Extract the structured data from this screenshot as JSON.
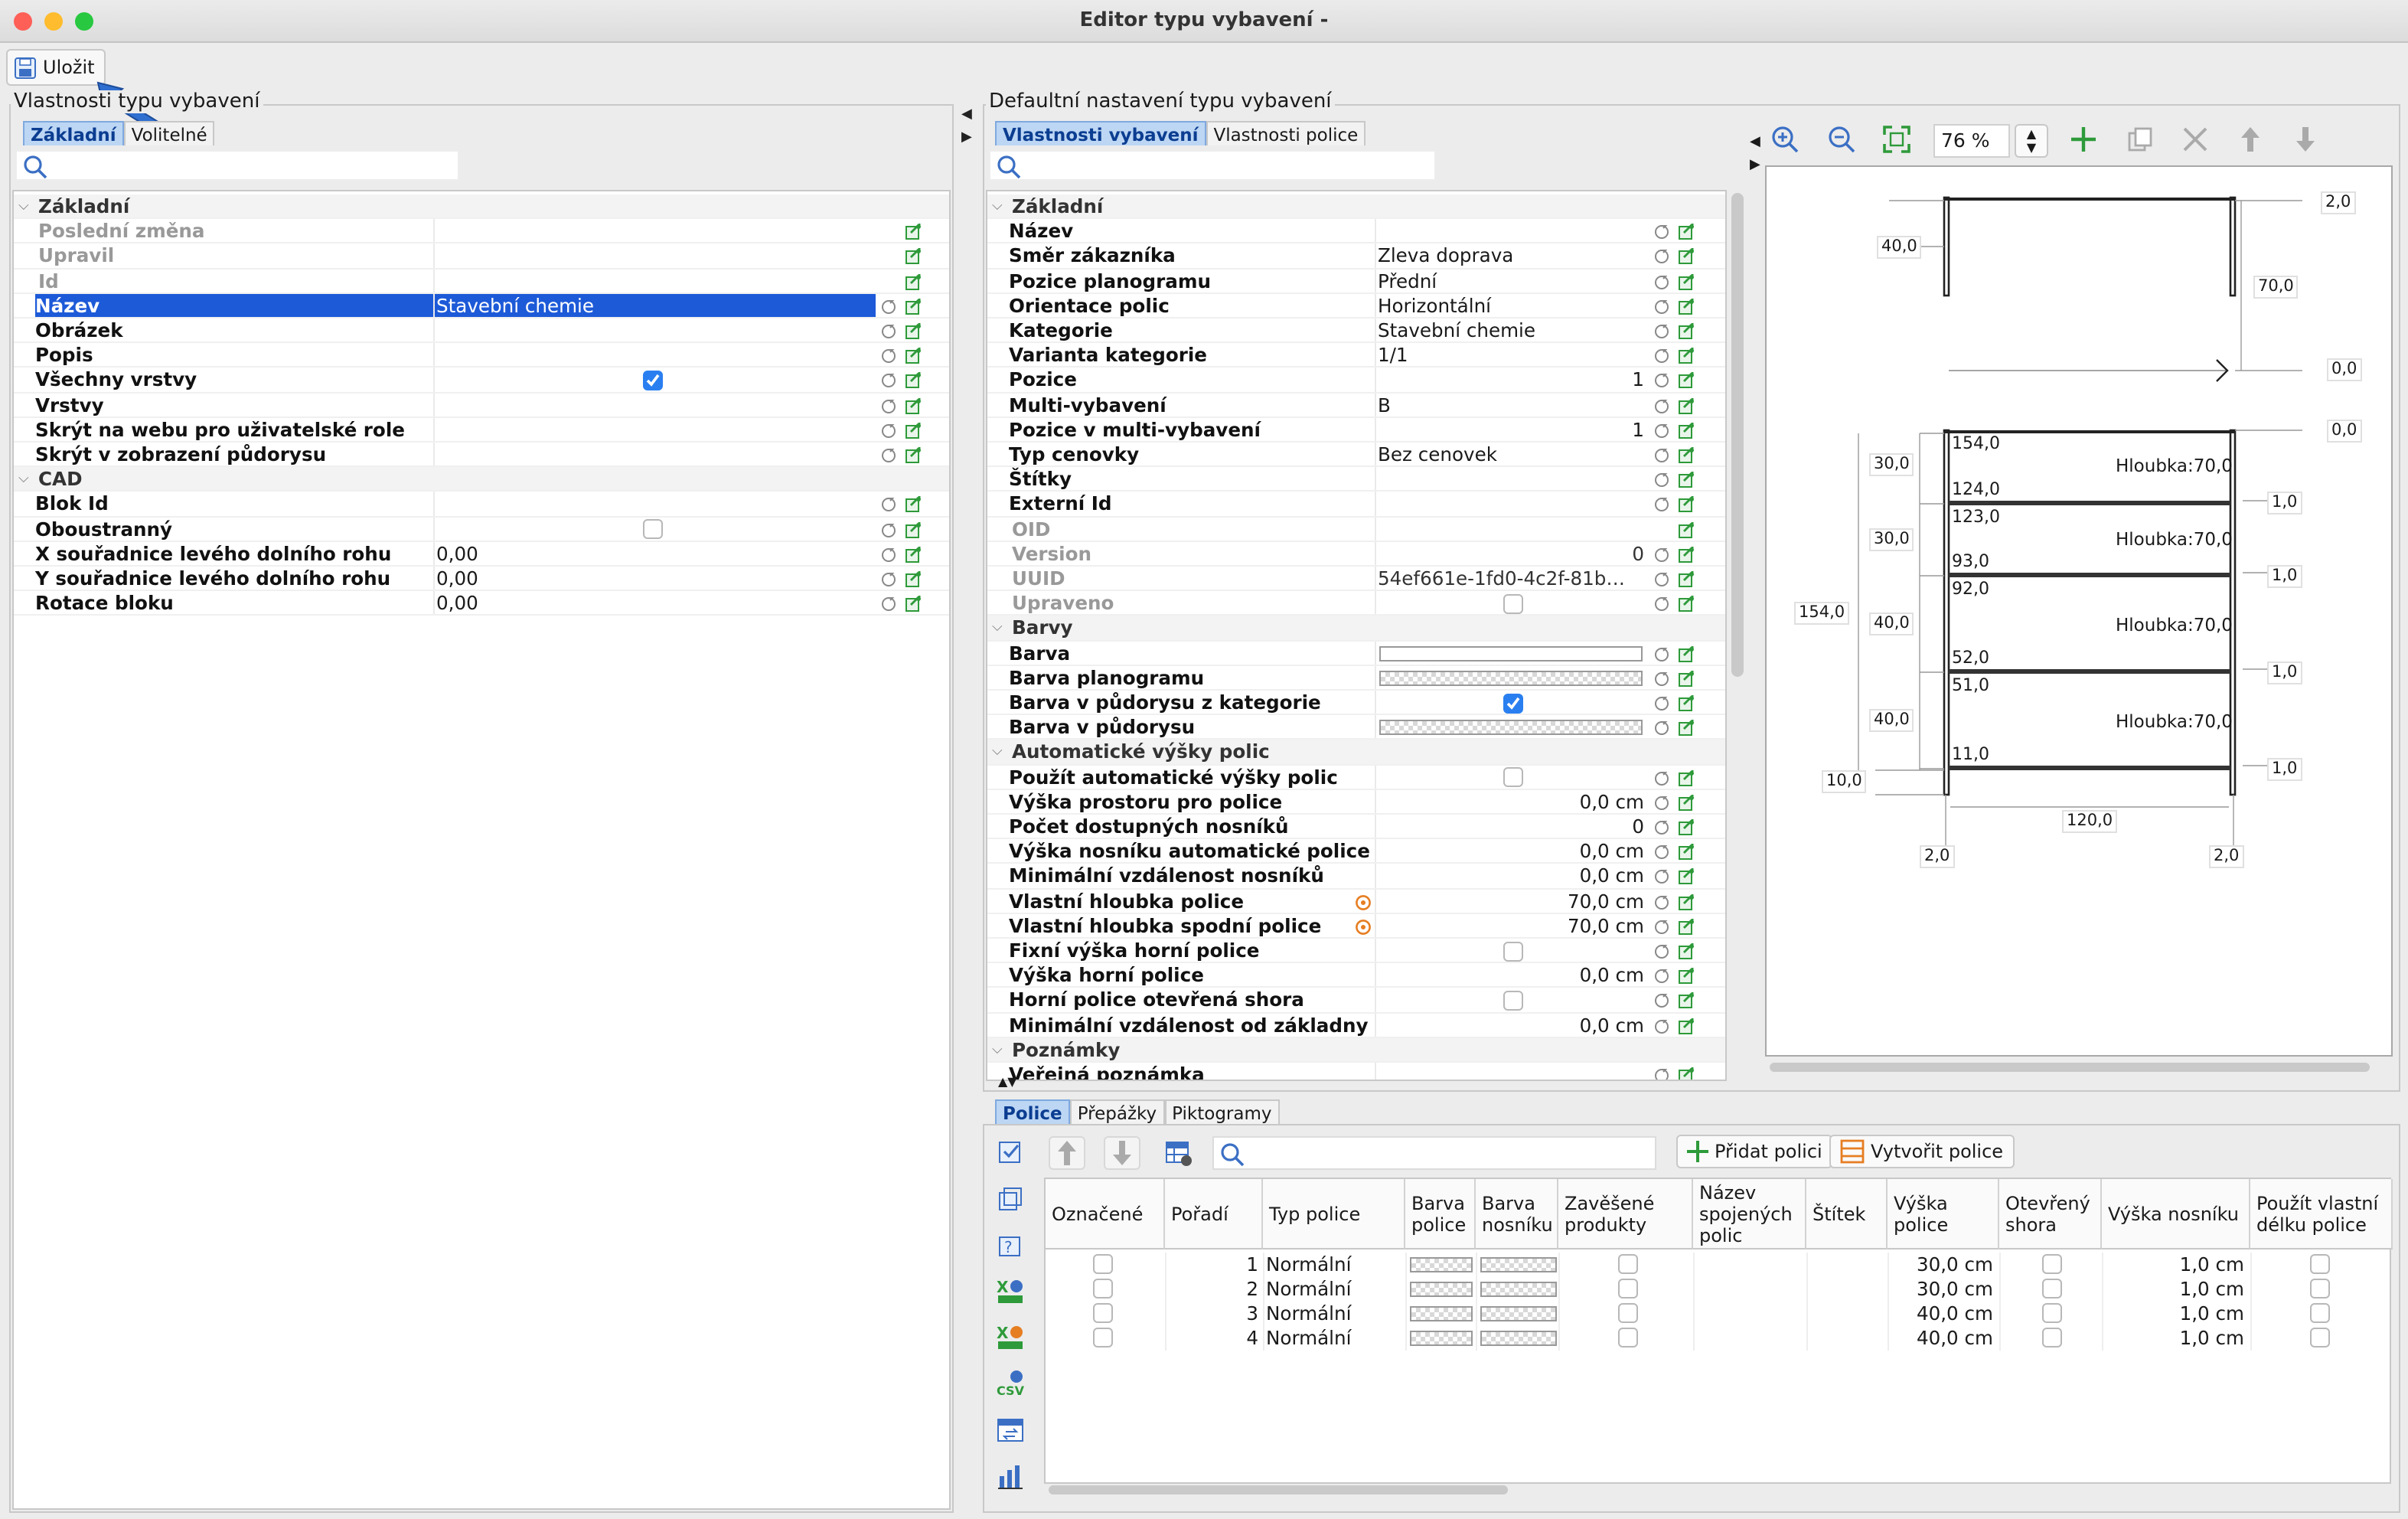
{
  "window": {
    "title": "Editor typu vybavení -"
  },
  "toolbar": {
    "save_label": "Uložit"
  },
  "left_panel": {
    "title": "Vlastnosti typu vybavení",
    "tabs": [
      "Základní",
      "Volitelné"
    ],
    "rows": [
      {
        "type": "section",
        "label": "Základní"
      },
      {
        "label": "Poslední změna",
        "disabled": true,
        "value": ""
      },
      {
        "label": "Upravil",
        "disabled": true,
        "value": ""
      },
      {
        "label": "Id",
        "disabled": true,
        "value": ""
      },
      {
        "label": "Název",
        "value": "Stavební chemie",
        "selected": true
      },
      {
        "label": "Obrázek",
        "value": ""
      },
      {
        "label": "Popis",
        "value": ""
      },
      {
        "label": "Všechny vrstvy",
        "checkbox": true,
        "checked": true
      },
      {
        "label": "Vrstvy",
        "value": ""
      },
      {
        "label": "Skrýt na webu pro uživatelské role",
        "value": ""
      },
      {
        "label": "Skrýt v zobrazení půdorysu",
        "value": ""
      },
      {
        "type": "section",
        "label": "CAD"
      },
      {
        "label": "Blok Id",
        "value": ""
      },
      {
        "label": "Oboustranný",
        "checkbox": true,
        "checked": false
      },
      {
        "label": "X souřadnice levého dolního rohu",
        "value": "0,00"
      },
      {
        "label": "Y souřadnice levého dolního rohu",
        "value": "0,00"
      },
      {
        "label": "Rotace bloku",
        "value": "0,00"
      }
    ]
  },
  "right_panel": {
    "title": "Defaultní nastavení typu vybavení",
    "tabs": [
      "Vlastnosti vybavení",
      "Vlastnosti police"
    ],
    "zoom": "76 %",
    "rows": [
      {
        "type": "section",
        "label": "Základní"
      },
      {
        "label": "Název",
        "value": ""
      },
      {
        "label": "Směr zákazníka",
        "value": "Zleva doprava"
      },
      {
        "label": "Pozice planogramu",
        "value": "Přední"
      },
      {
        "label": "Orientace polic",
        "value": "Horizontální"
      },
      {
        "label": "Kategorie",
        "value": "Stavební chemie"
      },
      {
        "label": "Varianta kategorie",
        "value": "1/1"
      },
      {
        "label": "Pozice",
        "value": "1",
        "align": "right"
      },
      {
        "label": "Multi-vybavení",
        "value": "B"
      },
      {
        "label": "Pozice v multi-vybavení",
        "value": "1",
        "align": "right"
      },
      {
        "label": "Typ cenovky",
        "value": "Bez cenovek"
      },
      {
        "label": "Štítky",
        "value": ""
      },
      {
        "label": "Externí Id",
        "value": ""
      },
      {
        "label": "OID",
        "disabled": true,
        "value": ""
      },
      {
        "label": "Version",
        "disabled": true,
        "value": "0",
        "align": "right"
      },
      {
        "label": "UUID",
        "disabled": true,
        "value": "54ef661e-1fd0-4c2f-81b…"
      },
      {
        "label": "Upraveno",
        "disabled": true,
        "checkbox": true,
        "checked": false
      },
      {
        "type": "section",
        "label": "Barvy"
      },
      {
        "label": "Barva",
        "swatch": "white"
      },
      {
        "label": "Barva planogramu",
        "swatch": "checker"
      },
      {
        "label": "Barva v půdorysu z kategorie",
        "checkbox": true,
        "checked": true
      },
      {
        "label": "Barva v půdorysu",
        "swatch": "checker"
      },
      {
        "type": "section",
        "label": "Automatické výšky polic"
      },
      {
        "label": "Použít automatické výšky polic",
        "checkbox": true,
        "checked": false
      },
      {
        "label": "Výška prostoru pro police",
        "value": "0,0 cm",
        "align": "right"
      },
      {
        "label": "Počet dostupných nosníků",
        "value": "0",
        "align": "right"
      },
      {
        "label": "Výška nosníku automatické police",
        "value": "0,0 cm",
        "align": "right"
      },
      {
        "label": "Minimální vzdálenost nosníků",
        "value": "0,0 cm",
        "align": "right"
      },
      {
        "label": "Vlastní hloubka police",
        "value": "70,0 cm",
        "align": "right",
        "warn": true
      },
      {
        "label": "Vlastní hloubka spodní police",
        "value": "70,0 cm",
        "align": "right",
        "warn": true
      },
      {
        "label": "Fixní výška horní police",
        "checkbox": true,
        "checked": false
      },
      {
        "label": "Výška horní police",
        "value": "0,0 cm",
        "align": "right"
      },
      {
        "label": "Horní police otevřená shora",
        "checkbox": true,
        "checked": false
      },
      {
        "label": "Minimální vzdálenost od základny",
        "value": "0,0 cm",
        "align": "right"
      },
      {
        "type": "section",
        "label": "Poznámky"
      },
      {
        "label": "Veřejná poznámka",
        "value": ""
      }
    ]
  },
  "drawing": {
    "labels": {
      "top_right_20": "2,0",
      "top_40": "40,0",
      "top_70": "70,0",
      "mid_00a": "0,0",
      "mid_00b": "0,0",
      "s1_top": "154,0",
      "s1_bot": "124,0",
      "s2_top": "123,0",
      "s2_bot": "93,0",
      "s3_top": "92,0",
      "s3_bot": "52,0",
      "s4_top": "51,0",
      "s4_bot": "11,0",
      "depth": "Hloubka:70,0",
      "left_30a": "30,0",
      "left_30b": "30,0",
      "left_40a": "40,0",
      "left_40b": "40,0",
      "left_154": "154,0",
      "left_10": "10,0",
      "right_10a": "1,0",
      "right_10b": "1,0",
      "right_10c": "1,0",
      "right_10d": "1,0",
      "width_120": "120,0",
      "bot_20a": "2,0",
      "bot_20b": "2,0"
    }
  },
  "bottom": {
    "tabs": [
      "Police",
      "Přepážky",
      "Piktogramy"
    ],
    "add_shelf": "Přidat polici",
    "create_shelf": "Vytvořit police",
    "columns": [
      "Označené",
      "Pořadí",
      "Typ police",
      "Barva police",
      "Barva nosníku",
      "Zavěšené produkty",
      "Název spojených polic",
      "Štítek",
      "Výška police",
      "Otevřený shora",
      "Výška nosníku",
      "Použít vlastní délku police"
    ],
    "rows": [
      {
        "order": "1",
        "type": "Normální",
        "height": "30,0 cm",
        "beam": "1,0 cm"
      },
      {
        "order": "2",
        "type": "Normální",
        "height": "30,0 cm",
        "beam": "1,0 cm"
      },
      {
        "order": "3",
        "type": "Normální",
        "height": "40,0 cm",
        "beam": "1,0 cm"
      },
      {
        "order": "4",
        "type": "Normální",
        "height": "40,0 cm",
        "beam": "1,0 cm"
      }
    ]
  },
  "colors": {
    "accent": "#1d5ad8",
    "tab_selected": "#bcd6f4",
    "checkbox_on": "#2a7ff0",
    "warn": "#e67e22",
    "green": "#2e9a3a"
  }
}
